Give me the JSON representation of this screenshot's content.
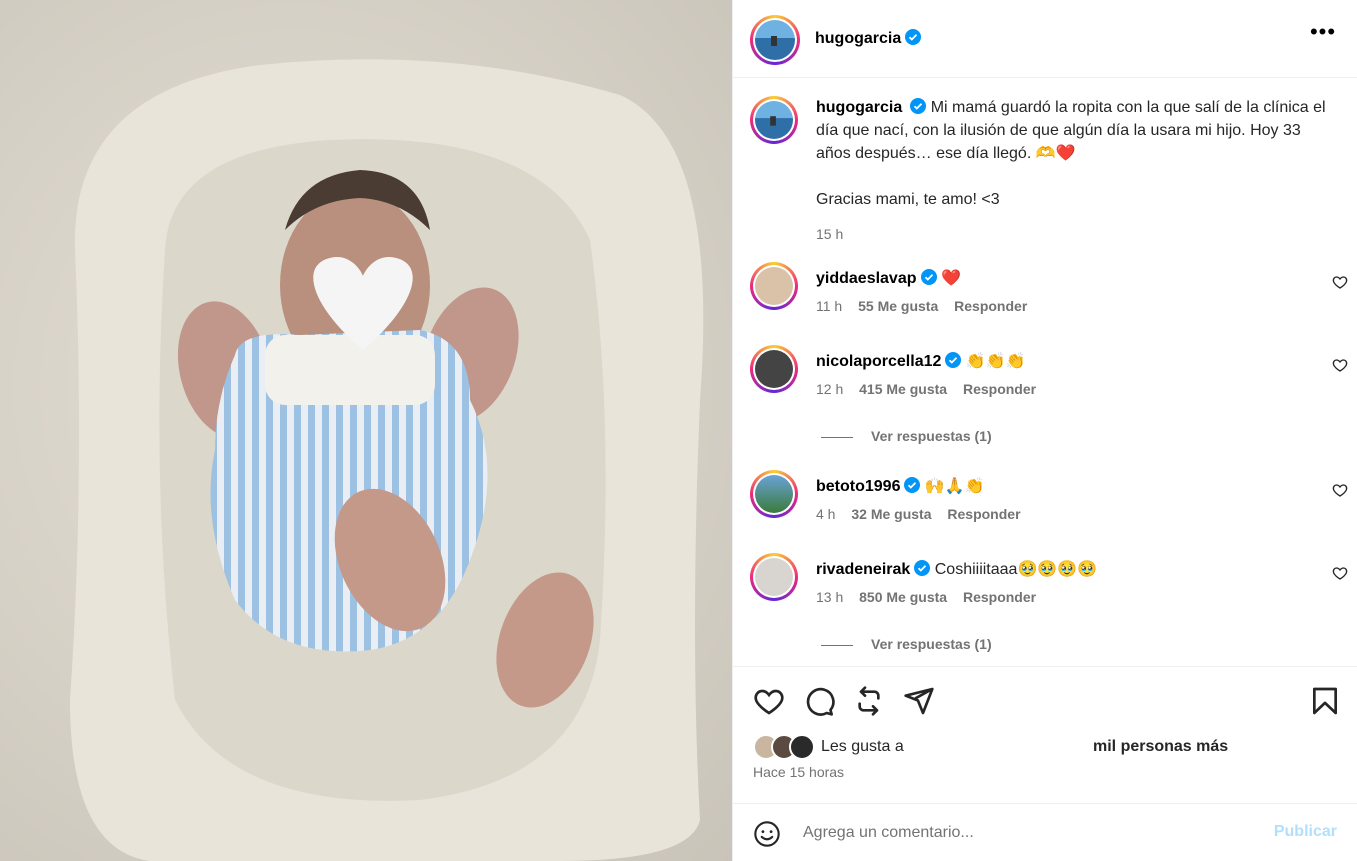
{
  "post": {
    "author": "hugogarcia",
    "caption": "Mi mamá guardó la ropita con la que salí de la clínica el día que nací, con la ilusión de que algún día la usara mi hijo. Hoy 33 años después… ese día llegó. 🫶❤️",
    "caption_second": "Gracias mami, te amo! <3",
    "caption_time": "15 h",
    "more_label": "•••"
  },
  "comments": [
    {
      "user": "yiddaeslavap",
      "text": "❤️",
      "time": "11 h",
      "likes": "55 Me gusta",
      "reply": "Responder"
    },
    {
      "user": "nicolaporcella12",
      "text": "👏👏👏",
      "time": "12 h",
      "likes": "415 Me gusta",
      "reply": "Responder",
      "see_replies": "Ver respuestas (1)"
    },
    {
      "user": "betoto1996",
      "text": "🙌🙏👏",
      "time": "4 h",
      "likes": "32 Me gusta",
      "reply": "Responder"
    },
    {
      "user": "rivadeneirak",
      "text": "Coshiiiitaaa🥹🥹🥹🥹",
      "time": "13 h",
      "likes": "850 Me gusta",
      "reply": "Responder",
      "see_replies": "Ver respuestas (1)"
    }
  ],
  "likes": {
    "prefix": "Les gusta a",
    "suffix": "mil personas más",
    "time_ago": "Hace 15 horas"
  },
  "comment_box": {
    "placeholder": "Agrega un comentario...",
    "publish": "Publicar"
  },
  "colors": {
    "verified": "#0095f6",
    "heart_red": "#e0245e",
    "publish_disabled": "#b2dffc"
  },
  "icons": {
    "verified": "verified-badge-icon",
    "like": "heart-icon",
    "comment": "comment-icon",
    "repost": "repost-icon",
    "share": "share-icon",
    "save": "bookmark-icon",
    "emoji": "emoji-icon"
  }
}
